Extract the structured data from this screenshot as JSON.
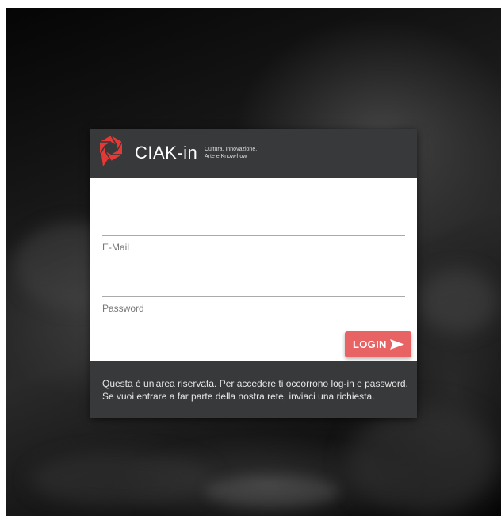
{
  "brand": {
    "name": "CIAK-in",
    "tagline_line1": "Cultura, Innovazione,",
    "tagline_line2": "Arte e Know-how",
    "accent_color": "#e53935"
  },
  "form": {
    "email_label": "E-Mail",
    "email_value": "",
    "password_label": "Password",
    "password_value": "",
    "login_label": "LOGIN",
    "login_icon": "send-icon",
    "button_color": "#e86464"
  },
  "notice": {
    "line1": "Questa è un'area riservata. Per accedere ti occorrono log-in e password.",
    "line2": "Se vuoi entrare a far parte della nostra rete, inviaci una richiesta."
  }
}
